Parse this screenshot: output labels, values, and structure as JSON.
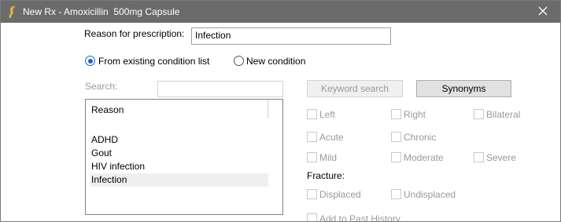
{
  "window": {
    "title": "New Rx - Amoxicillin  500mg Capsule"
  },
  "form": {
    "reason_label": "Reason for prescription:",
    "reason_value": "Infection",
    "radio_existing": "From existing condition list",
    "radio_new": "New condition",
    "search_label": "Search:",
    "search_value": "",
    "keyword_search": "Keyword search",
    "synonyms": "Synonyms"
  },
  "list": {
    "header": "Reason",
    "items": [
      "ADHD",
      "Gout",
      "HIV infection",
      "Infection"
    ],
    "selected": "Infection"
  },
  "qualifiers": {
    "left": "Left",
    "right": "Right",
    "bilateral": "Bilateral",
    "acute": "Acute",
    "chronic": "Chronic",
    "mild": "Mild",
    "moderate": "Moderate",
    "severe": "Severe",
    "fracture_label": "Fracture:",
    "displaced": "Displaced",
    "undisplaced": "Undisplaced",
    "add_past_history": "Add to Past History"
  }
}
